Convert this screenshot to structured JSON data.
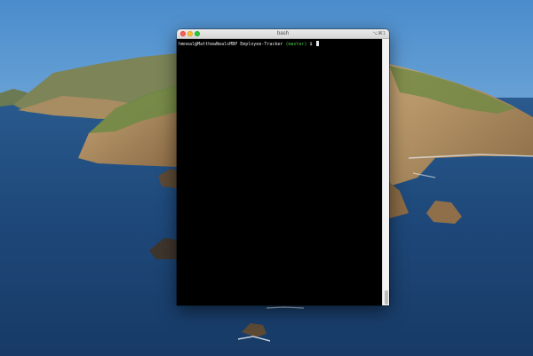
{
  "window": {
    "title": "bash",
    "shortcut": "⌥⌘1"
  },
  "terminal": {
    "user_host": "hmneal@MatthewNealsMBP",
    "directory": "Employee-Tracker",
    "branch": "(master)",
    "prompt_symbol": "$"
  },
  "colors": {
    "branch": "#4ec94e",
    "close": "#ff5f57",
    "minimize": "#ffbd2e",
    "maximize": "#28c940"
  },
  "icons": {
    "close": "close-icon",
    "minimize": "minimize-icon",
    "maximize": "maximize-icon"
  }
}
